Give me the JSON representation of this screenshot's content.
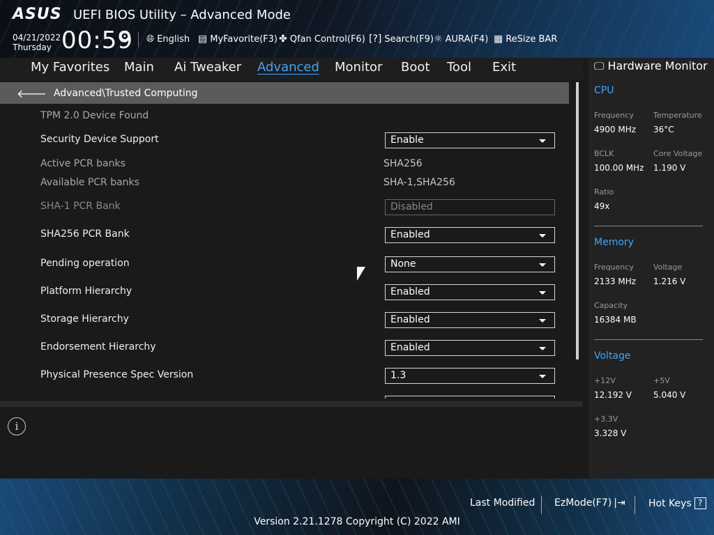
{
  "header": {
    "logo": "ASUS",
    "title": "UEFI BIOS Utility – Advanced Mode",
    "date": "04/21/2022",
    "day": "Thursday",
    "time": "00:59",
    "toolbar": [
      {
        "label": "English",
        "icon": "globe-icon"
      },
      {
        "label": "MyFavorite(F3)",
        "icon": "favorite-icon"
      },
      {
        "label": "Qfan Control(F6)",
        "icon": "fan-icon"
      },
      {
        "label": "Search(F9)",
        "icon": "search-icon"
      },
      {
        "label": "AURA(F4)",
        "icon": "aura-icon"
      },
      {
        "label": "ReSize BAR",
        "icon": "resize-bar-icon"
      }
    ]
  },
  "menu": {
    "items": [
      "My Favorites",
      "Main",
      "Ai Tweaker",
      "Advanced",
      "Monitor",
      "Boot",
      "Tool",
      "Exit"
    ],
    "active": "Advanced"
  },
  "breadcrumb": "Advanced\\Trusted Computing",
  "settings": {
    "device_found": "TPM 2.0 Device Found",
    "security_device_support": {
      "label": "Security Device Support",
      "value": "Enable"
    },
    "active_pcr_banks": {
      "label": "Active PCR banks",
      "value": "SHA256"
    },
    "available_pcr_banks": {
      "label": "Available PCR banks",
      "value": "SHA-1,SHA256"
    },
    "sha1_pcr_bank": {
      "label": "SHA-1 PCR Bank",
      "value": "Disabled"
    },
    "sha256_pcr_bank": {
      "label": "SHA256 PCR Bank",
      "value": "Enabled"
    },
    "pending_operation": {
      "label": "Pending operation",
      "value": "None"
    },
    "platform_hierarchy": {
      "label": "Platform Hierarchy",
      "value": "Enabled"
    },
    "storage_hierarchy": {
      "label": "Storage Hierarchy",
      "value": "Enabled"
    },
    "endorsement_hierarchy": {
      "label": "Endorsement Hierarchy",
      "value": "Enabled"
    },
    "physical_presence_spec": {
      "label": "Physical Presence Spec Version",
      "value": "1.3"
    }
  },
  "hardware_monitor": {
    "title": "Hardware Monitor",
    "cpu": {
      "heading": "CPU",
      "frequency_label": "Frequency",
      "frequency": "4900 MHz",
      "temperature_label": "Temperature",
      "temperature": "36°C",
      "bclk_label": "BCLK",
      "bclk": "100.00 MHz",
      "core_voltage_label": "Core Voltage",
      "core_voltage": "1.190 V",
      "ratio_label": "Ratio",
      "ratio": "49x"
    },
    "memory": {
      "heading": "Memory",
      "frequency_label": "Frequency",
      "frequency": "2133 MHz",
      "voltage_label": "Voltage",
      "voltage": "1.216 V",
      "capacity_label": "Capacity",
      "capacity": "16384 MB"
    },
    "voltage": {
      "heading": "Voltage",
      "v12_label": "+12V",
      "v12": "12.192 V",
      "v5_label": "+5V",
      "v5": "5.040 V",
      "v33_label": "+3.3V",
      "v33": "3.328 V"
    }
  },
  "footer": {
    "last_modified": "Last Modified",
    "ezmode": "EzMode(F7)",
    "hot_keys": "Hot Keys",
    "version": "Version 2.21.1278 Copyright (C) 2022 AMI"
  },
  "colors": {
    "accent": "#3aa7ff",
    "breadcrumb_bg": "#5b5b5b",
    "panel_bg": "#1a1a1a"
  }
}
